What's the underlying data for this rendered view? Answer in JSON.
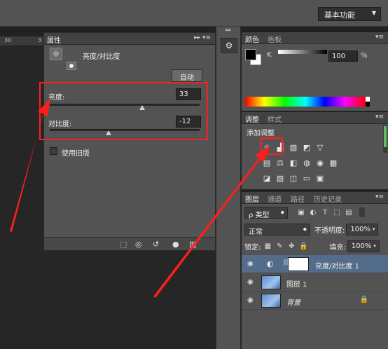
{
  "workspace": {
    "label": "基本功能"
  },
  "ruler": {
    "ticks": [
      "30",
      "3"
    ]
  },
  "properties": {
    "tab": "属性",
    "menu_ctrl": "▸▸ ▾≡",
    "adjustment_name": "亮度/对比度",
    "auto_button": "自动",
    "brightness_label": "亮度:",
    "brightness_value": "33",
    "contrast_label": "对比度:",
    "contrast_value": "-12",
    "legacy_label": "使用旧版",
    "footer_icons": [
      "clip-to-layer-icon",
      "view-previous-icon",
      "reset-icon",
      "visibility-icon",
      "delete-icon"
    ]
  },
  "color_panel": {
    "tabs": [
      "颜色",
      "色板"
    ],
    "channel": "K",
    "value": "100",
    "unit": "%"
  },
  "adjustments_panel": {
    "tabs": [
      "调整",
      "样式"
    ],
    "title": "添加调整"
  },
  "layers_panel": {
    "tabs": [
      "图层",
      "通道",
      "路径",
      "历史记录"
    ],
    "filter_label": "ρ 类型",
    "blend_mode": "正常",
    "opacity_label": "不透明度:",
    "opacity_value": "100%",
    "lock_label": "锁定:",
    "fill_label": "填充:",
    "fill_value": "100%",
    "layers": [
      {
        "name": "亮度/对比度 1",
        "selected": true
      },
      {
        "name": "图层 1",
        "selected": false
      },
      {
        "name": "背景",
        "selected": false
      }
    ]
  },
  "colors": {
    "highlight": "#ff1e1e",
    "selected_layer": "#536c8a"
  }
}
